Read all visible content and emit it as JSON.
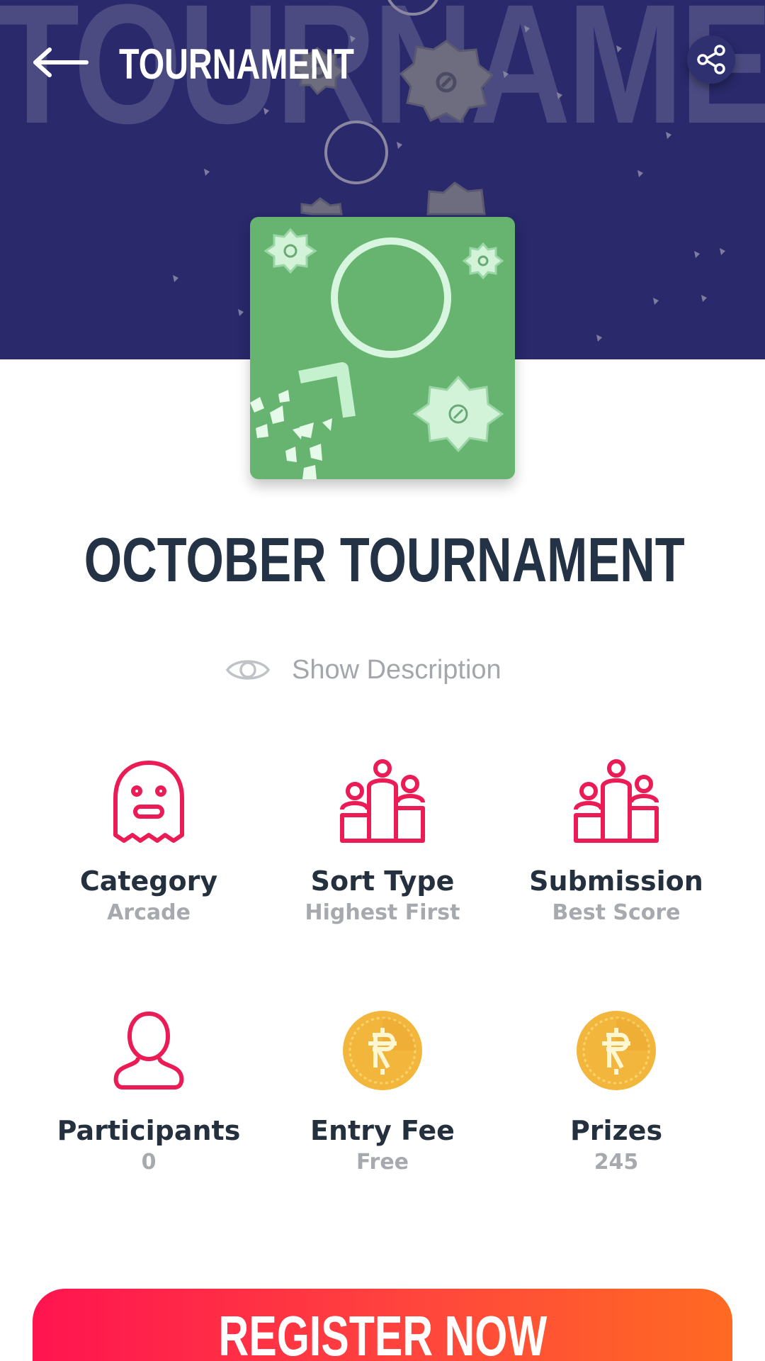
{
  "header": {
    "title": "TOURNAMENT",
    "watermark": "TOURNAMENT",
    "back_icon": "arrow-left-icon",
    "share_icon": "share-icon",
    "background_color": "#29296b"
  },
  "tournament": {
    "title": "OCTOBER TOURNAMENT",
    "show_description_label": "Show Description",
    "show_description_icon": "eye-icon",
    "thumbnail_color": "#66b46f"
  },
  "info": [
    {
      "icon": "ghost-icon",
      "label": "Category",
      "value": "Arcade"
    },
    {
      "icon": "podium-people-icon",
      "label": "Sort Type",
      "value": "Highest First"
    },
    {
      "icon": "podium-people-icon",
      "label": "Submission",
      "value": "Best Score"
    },
    {
      "icon": "user-icon",
      "label": "Participants",
      "value": "0"
    },
    {
      "icon": "coin-icon",
      "label": "Entry Fee",
      "value": "Free"
    },
    {
      "icon": "coin-icon",
      "label": "Prizes",
      "value": "245"
    }
  ],
  "register": {
    "label": "REGISTER NOW",
    "gradient": [
      "#ff1450",
      "#ff6a22"
    ]
  },
  "colors": {
    "accent": "#eb1b55",
    "title_text": "#243245",
    "muted_text": "#a6a9ad",
    "coin": "#f3b63c"
  }
}
